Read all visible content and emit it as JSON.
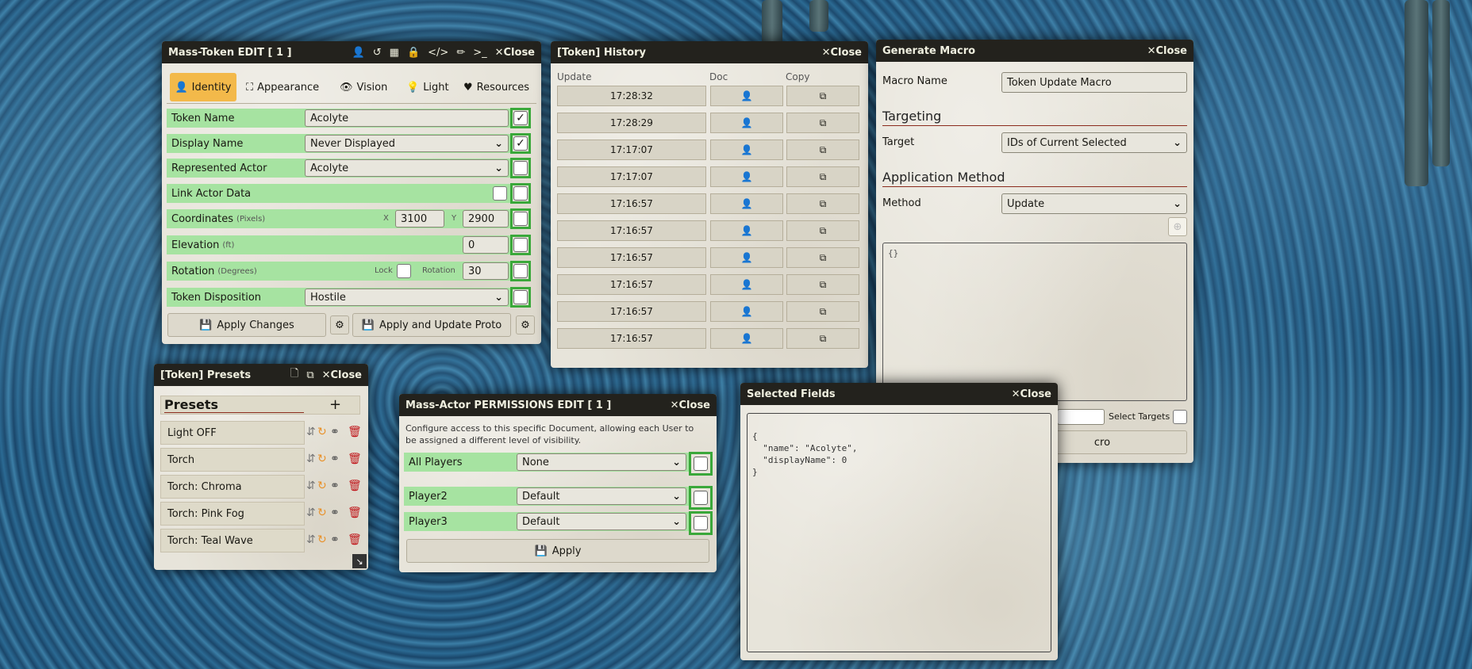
{
  "token_edit": {
    "title": "Mass-Token EDIT [ 1 ]",
    "close": "✕Close",
    "header_icons": [
      "user-icon",
      "history-icon",
      "calendar-icon",
      "lock-icon",
      "code-icon",
      "brush-icon",
      "terminal-icon"
    ],
    "tabs": [
      {
        "label": "Identity",
        "icon": "user-icon",
        "active": true
      },
      {
        "label": "Appearance",
        "icon": "expand-icon"
      },
      {
        "label": "Vision",
        "icon": "eye-icon"
      },
      {
        "label": "Light",
        "icon": "bulb-icon"
      },
      {
        "label": "Resources",
        "icon": "heart-icon"
      }
    ],
    "token_name_label": "Token Name",
    "token_name_value": "Acolyte",
    "display_name_label": "Display Name",
    "display_name_value": "Never Displayed",
    "represented_actor_label": "Represented Actor",
    "represented_actor_value": "Acolyte",
    "link_actor_label": "Link Actor Data",
    "coordinates_label": "Coordinates",
    "coordinates_unit": "(Pixels)",
    "x_label": "X",
    "x_value": "3100",
    "y_label": "Y",
    "y_value": "2900",
    "elevation_label": "Elevation",
    "elevation_unit": "(ft)",
    "elevation_value": "0",
    "rotation_label": "Rotation",
    "rotation_unit": "(Degrees)",
    "lock_label": "Lock",
    "rotation_sub_label": "Rotation",
    "rotation_value": "30",
    "disposition_label": "Token Disposition",
    "disposition_value": "Hostile",
    "apply_label": "Apply Changes",
    "apply_proto_label": "Apply and Update Proto",
    "checks": [
      true,
      true,
      false,
      false,
      false,
      false,
      false,
      false
    ]
  },
  "history": {
    "title": "[Token] History",
    "close": "✕Close",
    "col_update": "Update",
    "col_doc": "Doc",
    "col_copy": "Copy",
    "rows": [
      "17:28:32",
      "17:28:29",
      "17:17:07",
      "17:17:07",
      "17:16:57",
      "17:16:57",
      "17:16:57",
      "17:16:57",
      "17:16:57",
      "17:16:57"
    ]
  },
  "macro": {
    "title": "Generate Macro",
    "close": "✕Close",
    "macro_name_label": "Macro Name",
    "macro_name_value": "Token Update Macro",
    "targeting_title": "Targeting",
    "target_label": "Target",
    "target_value": "IDs of Current Selected",
    "method_title": "Application Method",
    "method_label": "Method",
    "method_value": "Update",
    "textarea_value": "{}",
    "select_targets_label": "Select Targets",
    "generate_fragment": "cro"
  },
  "presets": {
    "title": "[Token] Presets",
    "close": "✕Close",
    "heading": "Presets",
    "add": "+",
    "items": [
      "Light OFF",
      "Torch",
      "Torch: Chroma",
      "Torch: Pink Fog",
      "Torch: Teal Wave"
    ]
  },
  "permissions": {
    "title": "Mass-Actor PERMISSIONS EDIT [ 1 ]",
    "close": "✕Close",
    "description": "Configure access to this specific Document, allowing each User to be assigned a different level of visibility.",
    "rows": [
      {
        "label": "All Players",
        "value": "None"
      },
      {
        "label": "Player2",
        "value": "Default"
      },
      {
        "label": "Player3",
        "value": "Default"
      }
    ],
    "apply_label": "Apply"
  },
  "selected_fields": {
    "title": "Selected Fields",
    "close": "✕Close",
    "line1": "{",
    "line2": "  \"name\": \"Acolyte\",",
    "line3": "  \"displayName\": 0",
    "line4": "}"
  },
  "colors": {
    "accent_tab": "#f3b94a",
    "row_green": "#a6e3a1",
    "check_green": "#3aa83a",
    "header_dark": "#23221d",
    "delete_red": "#c0161b",
    "sync_orange": "#e8912a"
  }
}
